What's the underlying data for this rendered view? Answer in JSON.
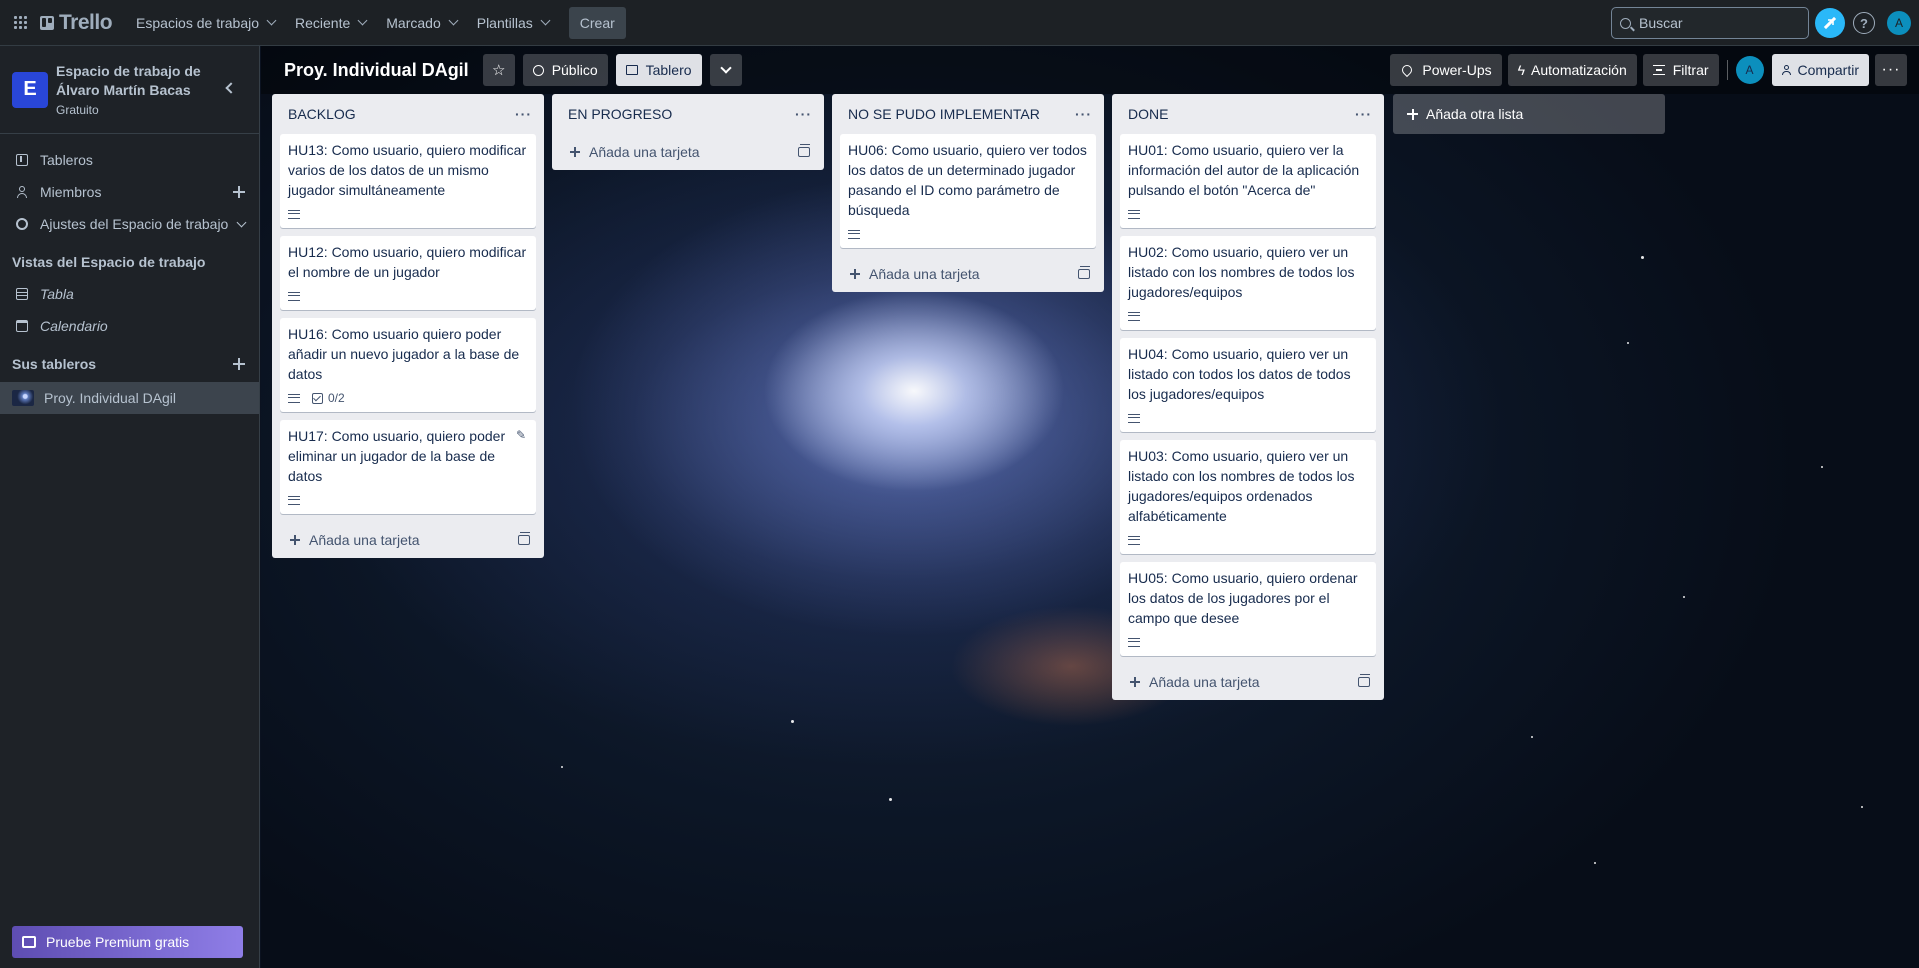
{
  "topbar": {
    "app_name": "Trello",
    "menus": [
      "Espacios de trabajo",
      "Reciente",
      "Marcado",
      "Plantillas"
    ],
    "create_label": "Crear",
    "search_placeholder": "Buscar",
    "help_label": "?",
    "avatar_initial": "A"
  },
  "sidebar": {
    "workspace_initial": "E",
    "workspace_name": "Espacio de trabajo de Álvaro Martín Bacas",
    "workspace_plan": "Gratuito",
    "items": [
      {
        "label": "Tableros",
        "icon": "board-icon"
      },
      {
        "label": "Miembros",
        "icon": "person-icon"
      },
      {
        "label": "Ajustes del Espacio de trabajo",
        "icon": "gear-icon"
      }
    ],
    "views_title": "Vistas del Espacio de trabajo",
    "views": [
      {
        "label": "Tabla",
        "icon": "table-icon"
      },
      {
        "label": "Calendario",
        "icon": "calendar-icon"
      }
    ],
    "boards_title": "Sus tableros",
    "boards": [
      {
        "label": "Proy. Individual DAgil"
      }
    ],
    "premium_label": "Pruebe Premium gratis"
  },
  "board": {
    "title": "Proy. Individual DAgil",
    "visibility": "Público",
    "view": "Tablero",
    "powerups_label": "Power-Ups",
    "automation_label": "Automatización",
    "filter_label": "Filtrar",
    "member_initial": "A",
    "share_label": "Compartir",
    "more_label": "···"
  },
  "lists": [
    {
      "title": "BACKLOG",
      "add_label": "Añada una tarjeta",
      "cards": [
        {
          "text": "HU13: Como usuario, quiero modificar varios de los datos de un mismo jugador simultáneamente",
          "checklist": ""
        },
        {
          "text": "HU12: Como usuario, quiero modificar el nombre de un jugador",
          "checklist": ""
        },
        {
          "text": "HU16: Como usuario quiero poder añadir un nuevo jugador a la base de datos",
          "checklist": "0/2"
        },
        {
          "text": "HU17: Como usuario, quiero poder eliminar un jugador de la base de datos",
          "checklist": ""
        }
      ]
    },
    {
      "title": "EN PROGRESO",
      "add_label": "Añada una tarjeta",
      "cards": []
    },
    {
      "title": "NO SE PUDO IMPLEMENTAR",
      "add_label": "Añada una tarjeta",
      "cards": [
        {
          "text": "HU06: Como usuario, quiero ver todos los datos de un determinado jugador pasando el ID como parámetro de búsqueda",
          "checklist": ""
        }
      ]
    },
    {
      "title": "DONE",
      "add_label": "Añada una tarjeta",
      "cards": [
        {
          "text": "HU01: Como usuario, quiero ver la información del autor de la aplicación pulsando el botón \"Acerca de\"",
          "checklist": ""
        },
        {
          "text": "HU02: Como usuario, quiero ver un listado con los nombres de todos los jugadores/equipos",
          "checklist": ""
        },
        {
          "text": "HU04: Como usuario, quiero ver un listado con todos los datos de todos los jugadores/equipos",
          "checklist": ""
        },
        {
          "text": "HU03: Como usuario, quiero ver un listado con los nombres de todos los jugadores/equipos ordenados alfabéticamente",
          "checklist": ""
        },
        {
          "text": "HU05: Como usuario, quiero ordenar los datos de los jugadores por el campo que desee",
          "checklist": ""
        }
      ]
    }
  ],
  "add_list_label": "Añada otra lista"
}
